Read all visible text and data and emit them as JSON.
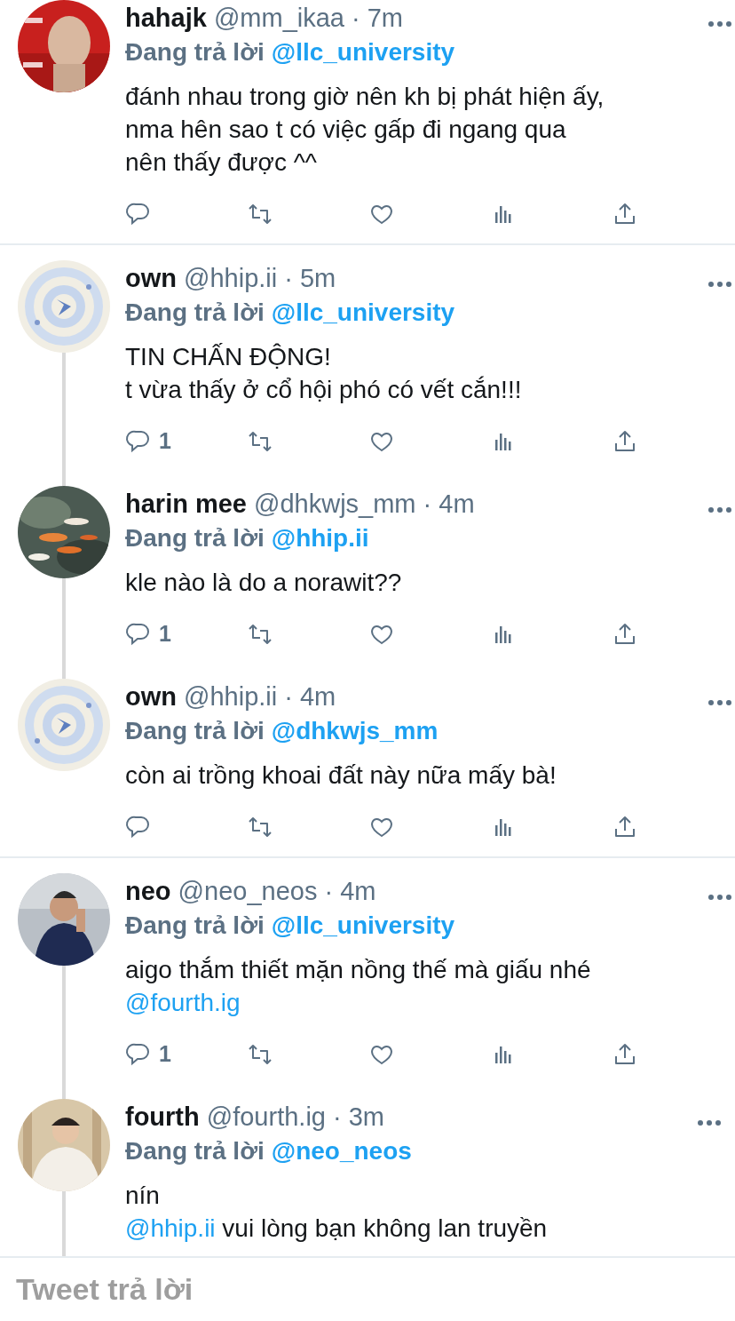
{
  "tweets": [
    {
      "avatar": {
        "kind": "picture"
      },
      "name": "hahajk",
      "meta": "@mm_ikaa · 7m",
      "replying_label": "Đang trả lời",
      "replying_to": "@llc_university",
      "body": [
        [
          {
            "kind": "text",
            "text": "đánh nhau trong giờ nên kh bị phát hiện ấy,"
          }
        ],
        [
          {
            "kind": "text",
            "text": "nma hên sao t có việc gấp đi ngang qua"
          }
        ],
        [
          {
            "kind": "text",
            "text": "nên thấy được ^^"
          }
        ]
      ],
      "actions_shown": true,
      "thread_continues": false,
      "divider": true
    },
    {
      "avatar": {
        "kind": "picture"
      },
      "name": "own",
      "meta": "@hhip.ii · 5m",
      "replying_label": "Đang trả lời",
      "replying_to": "@llc_university",
      "body": [
        [
          {
            "kind": "text",
            "text": "TIN CHẤN ĐỘNG!"
          }
        ],
        [
          {
            "kind": "text",
            "text": "t vừa thấy ở cổ hội phó có vết cắn!!!"
          }
        ]
      ],
      "reply_count": "1",
      "actions_shown": true,
      "thread_continues": true,
      "divider": false
    },
    {
      "avatar": {
        "kind": "picture"
      },
      "name": "harin mee",
      "meta": "@dhkwjs_mm · 4m",
      "replying_label": "Đang trả lời",
      "replying_to": "@hhip.ii",
      "body": [
        [
          {
            "kind": "text",
            "text": "kle nào là do a norawit??"
          }
        ]
      ],
      "reply_count": "1",
      "actions_shown": true,
      "thread_continues": true,
      "divider": false
    },
    {
      "avatar": {
        "kind": "picture"
      },
      "name": "own",
      "meta": "@hhip.ii · 4m",
      "replying_label": "Đang trả lời",
      "replying_to": "@dhkwjs_mm",
      "body": [
        [
          {
            "kind": "text",
            "text": "còn ai trồng khoai đất này nữa mấy bà!"
          }
        ]
      ],
      "actions_shown": true,
      "thread_continues": false,
      "divider": true
    },
    {
      "avatar": {
        "kind": "picture"
      },
      "name": "neo",
      "meta": "@neo_neos · 4m",
      "replying_label": "Đang trả lời",
      "replying_to": "@llc_university",
      "body": [
        [
          {
            "kind": "text",
            "text": "aigo thắm thiết mặn nồng thế mà giấu nhé"
          }
        ],
        [
          {
            "kind": "mention",
            "text": "@fourth.ig"
          }
        ]
      ],
      "reply_count": "1",
      "actions_shown": true,
      "thread_continues": true,
      "divider": false
    },
    {
      "avatar": {
        "kind": "picture"
      },
      "name": "fourth",
      "meta": "@fourth.ig · 3m",
      "replying_label": "Đang trả lời",
      "replying_to": "@neo_neos",
      "body": [
        [
          {
            "kind": "text",
            "text": "nín"
          }
        ],
        [
          {
            "kind": "mention",
            "text": "@hhip.ii"
          },
          {
            "kind": "text",
            "text": " vui lòng bạn không lan truyền"
          }
        ]
      ],
      "actions_shown": false,
      "thread_continues": true,
      "divider": false
    }
  ],
  "reply_box": {
    "placeholder": "Tweet trả lời"
  }
}
